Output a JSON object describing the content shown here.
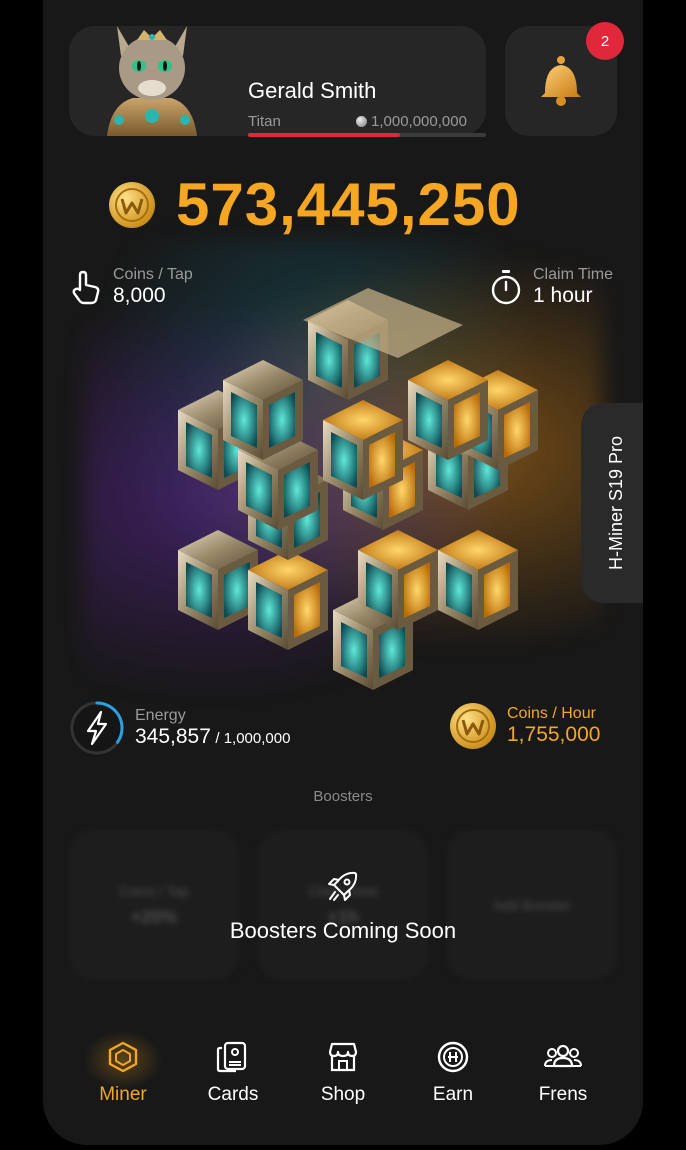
{
  "profile": {
    "name": "Gerald Smith",
    "rank": "Titan",
    "goal": "1,000,000,000",
    "progress": 0.64
  },
  "notifications": {
    "count": "2"
  },
  "balance": "573,445,250",
  "coins_per_tap": {
    "label": "Coins / Tap",
    "value": "8,000"
  },
  "claim_time": {
    "label": "Claim Time",
    "value": "1 hour"
  },
  "miner_name": "H-Miner S19 Pro",
  "energy": {
    "label": "Energy",
    "value": "345,857",
    "max": "/ 1,000,000",
    "fraction": 0.346
  },
  "coins_per_hour": {
    "label": "Coins / Hour",
    "value": "1,755,000"
  },
  "boosters": {
    "title": "Boosters",
    "cards": [
      {
        "label": "Coins / Tap",
        "value": "+20%"
      },
      {
        "label": "Claim Time",
        "value": "+1h"
      },
      {
        "label": "Add Booster",
        "value": ""
      }
    ],
    "coming_soon": "Boosters Coming Soon"
  },
  "nav": [
    {
      "label": "Miner",
      "icon": "miner-icon",
      "active": true
    },
    {
      "label": "Cards",
      "icon": "cards-icon",
      "active": false
    },
    {
      "label": "Shop",
      "icon": "shop-icon",
      "active": false
    },
    {
      "label": "Earn",
      "icon": "earn-icon",
      "active": false
    },
    {
      "label": "Frens",
      "icon": "frens-icon",
      "active": false
    }
  ],
  "colors": {
    "accent": "#f5a623",
    "danger": "#e0283a",
    "energy": "#2b9fe0",
    "background": "#181818"
  }
}
